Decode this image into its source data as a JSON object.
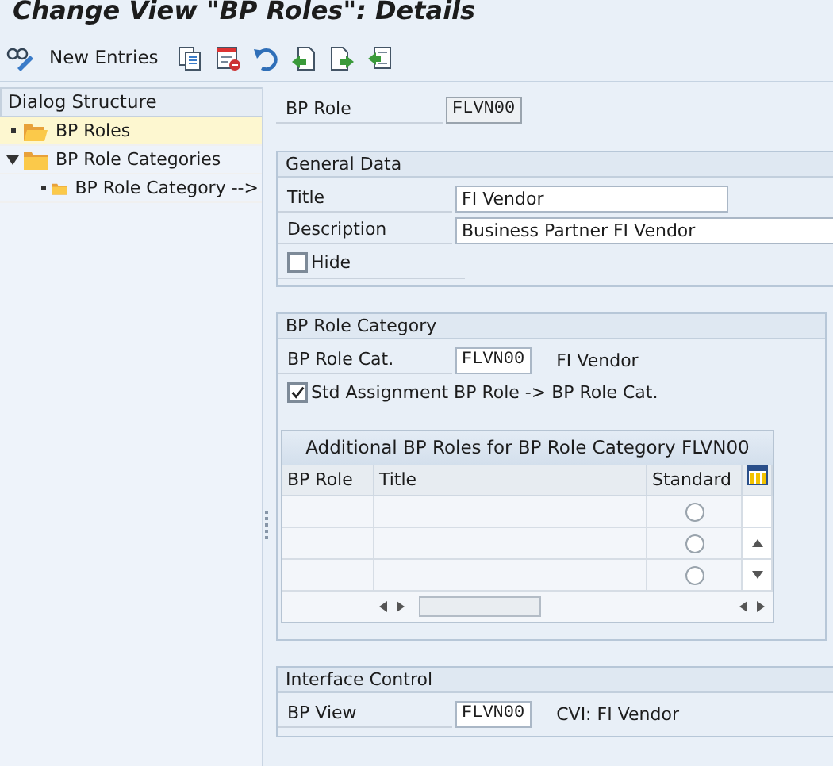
{
  "window": {
    "title": "Change View \"BP Roles\": Details"
  },
  "toolbar": {
    "items": [
      {
        "kind": "icon"
      },
      {
        "kind": "text",
        "label": "New Entries"
      },
      {
        "kind": "icon"
      },
      {
        "kind": "icon"
      },
      {
        "kind": "icon"
      },
      {
        "kind": "icon"
      },
      {
        "kind": "icon"
      },
      {
        "kind": "icon"
      }
    ]
  },
  "sidebar": {
    "title": "Dialog Structure",
    "items": [
      {
        "label": "BP Roles",
        "selected": true
      },
      {
        "label": "BP Role Categories",
        "selected": false,
        "expanded": true,
        "children": [
          {
            "label": "BP Role Category -->",
            "selected": false
          }
        ]
      }
    ]
  },
  "header": {
    "label": "BP Role",
    "value": "FLVN00"
  },
  "general_data": {
    "title": "General Data",
    "fields": [
      {
        "label": "Title",
        "value": "FI Vendor"
      },
      {
        "label": "Description",
        "value": "Business Partner FI Vendor"
      }
    ],
    "hide": {
      "label": "Hide",
      "checked": false
    }
  },
  "role_category": {
    "title": "BP Role Category",
    "field": {
      "label": "BP Role Cat.",
      "value": "FLVN00",
      "text": "FI Vendor"
    },
    "std_assignment": {
      "label": "Std Assignment BP Role -> BP Role Cat.",
      "checked": true
    },
    "table": {
      "title": "Additional BP Roles for BP Role Category FLVN00",
      "columns": [
        "BP Role",
        "Title",
        "Standard"
      ],
      "rows": [
        {
          "standard": false
        },
        {
          "standard": false
        },
        {
          "standard": false
        }
      ]
    }
  },
  "interface_control": {
    "title": "Interface Control",
    "field": {
      "label": "BP View",
      "value": "FLVN00",
      "text": "CVI: FI Vendor"
    }
  }
}
